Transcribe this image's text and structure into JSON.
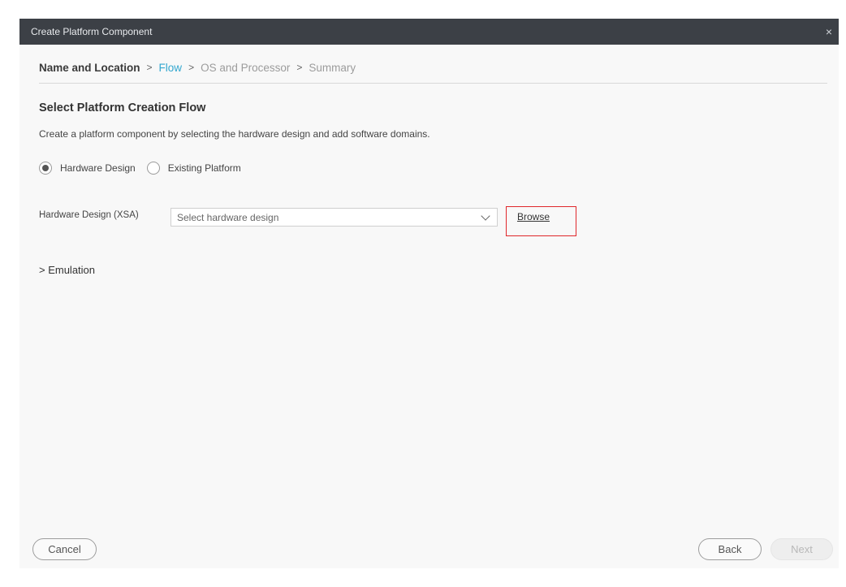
{
  "window": {
    "title": "Create Platform Component",
    "close_icon": "×"
  },
  "breadcrumb": {
    "separator": ">",
    "steps": [
      "Name and Location",
      "Flow",
      "OS and Processor",
      "Summary"
    ],
    "active_index": 1
  },
  "section": {
    "heading": "Select Platform Creation Flow",
    "description": "Create a platform component by selecting the hardware design and add software domains."
  },
  "flow_options": {
    "hardware_design": "Hardware Design",
    "existing_platform": "Existing Platform",
    "selected": "Hardware Design"
  },
  "hardware_design": {
    "label": "Hardware Design (XSA)",
    "placeholder": "Select hardware design",
    "browse_label": "Browse"
  },
  "emulation": {
    "label": "> Emulation"
  },
  "footer": {
    "cancel": "Cancel",
    "back": "Back",
    "next": "Next"
  },
  "colors": {
    "titlebar": "#3c4046",
    "active_step": "#33a7cf",
    "highlight_box": "#e0272b"
  }
}
